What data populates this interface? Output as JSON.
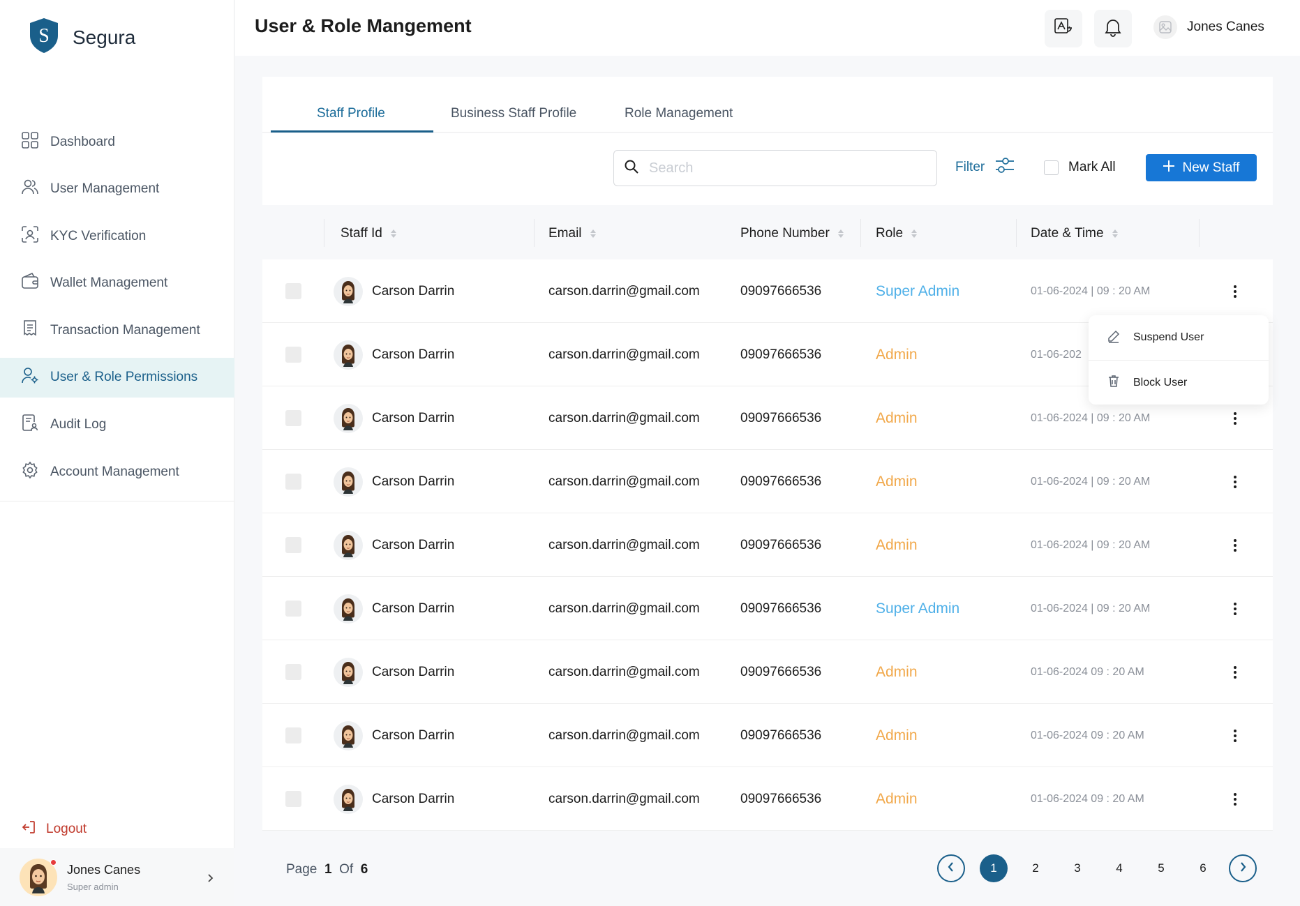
{
  "brand": {
    "name": "Segura",
    "logo_letter": "S"
  },
  "sidebar": {
    "items": [
      {
        "label": "Dashboard",
        "icon": "grid-icon"
      },
      {
        "label": "User Management",
        "icon": "users-icon"
      },
      {
        "label": "KYC Verification",
        "icon": "face-scan-icon"
      },
      {
        "label": "Wallet Management",
        "icon": "wallet-icon"
      },
      {
        "label": "Transaction Management",
        "icon": "receipt-icon"
      },
      {
        "label": "User & Role Permissions",
        "icon": "user-gear-icon",
        "active": true
      },
      {
        "label": "Audit Log",
        "icon": "document-user-icon"
      },
      {
        "label": "Account Management",
        "icon": "gear-icon"
      }
    ],
    "logout_label": "Logout",
    "profile": {
      "name": "Jones Canes",
      "role": "Super admin"
    }
  },
  "header": {
    "title": "User & Role Mangement",
    "user_name": "Jones Canes"
  },
  "tabs": [
    {
      "label": "Staff Profile",
      "active": true
    },
    {
      "label": "Business Staff Profile"
    },
    {
      "label": "Role Management"
    }
  ],
  "toolbar": {
    "search_placeholder": "Search",
    "filter_label": "Filter",
    "mark_all_label": "Mark All",
    "new_staff_label": "New Staff"
  },
  "table": {
    "columns": [
      "Staff Id",
      "Email",
      "Phone Number",
      "Role",
      "Date & Time"
    ],
    "rows": [
      {
        "name": "Carson Darrin",
        "email": "carson.darrin@gmail.com",
        "phone": "09097666536",
        "role": "Super Admin",
        "datetime": "01-06-2024  |  09 : 20 AM"
      },
      {
        "name": "Carson Darrin",
        "email": "carson.darrin@gmail.com",
        "phone": "09097666536",
        "role": "Admin",
        "datetime": "01-06-202"
      },
      {
        "name": "Carson Darrin",
        "email": "carson.darrin@gmail.com",
        "phone": "09097666536",
        "role": "Admin",
        "datetime": "01-06-2024  |  09 : 20 AM"
      },
      {
        "name": "Carson Darrin",
        "email": "carson.darrin@gmail.com",
        "phone": "09097666536",
        "role": "Admin",
        "datetime": "01-06-2024  |  09 : 20 AM"
      },
      {
        "name": "Carson Darrin",
        "email": "carson.darrin@gmail.com",
        "phone": "09097666536",
        "role": "Admin",
        "datetime": "01-06-2024  |  09 : 20 AM"
      },
      {
        "name": "Carson Darrin",
        "email": "carson.darrin@gmail.com",
        "phone": "09097666536",
        "role": "Super Admin",
        "datetime": "01-06-2024  |  09 : 20 AM"
      },
      {
        "name": "Carson Darrin",
        "email": "carson.darrin@gmail.com",
        "phone": "09097666536",
        "role": "Admin",
        "datetime": "01-06-2024  09 : 20 AM"
      },
      {
        "name": "Carson Darrin",
        "email": "carson.darrin@gmail.com",
        "phone": "09097666536",
        "role": "Admin",
        "datetime": "01-06-2024  09 : 20 AM"
      },
      {
        "name": "Carson Darrin",
        "email": "carson.darrin@gmail.com",
        "phone": "09097666536",
        "role": "Admin",
        "datetime": "01-06-2024  09 : 20 AM"
      }
    ]
  },
  "row_menu": {
    "suspend_label": "Suspend User",
    "block_label": "Block User"
  },
  "pagination": {
    "page_word": "Page",
    "current": "1",
    "of_word": "Of",
    "total": "6",
    "pages": [
      "1",
      "2",
      "3",
      "4",
      "5",
      "6"
    ]
  },
  "colors": {
    "primary": "#1a5f8a",
    "button": "#1777d6",
    "super_admin": "#4fb0e8",
    "admin": "#f1a84a",
    "logout": "#c0392b"
  }
}
